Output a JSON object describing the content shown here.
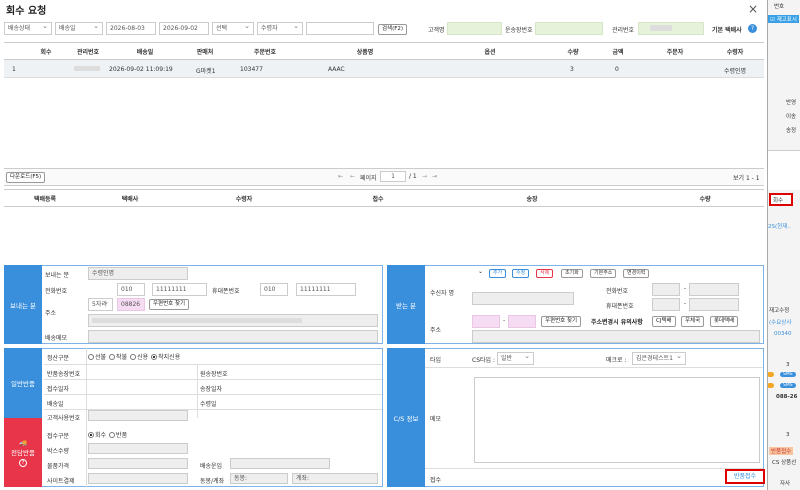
{
  "modal": {
    "title": "회수 요청",
    "close": "×"
  },
  "filters": {
    "status": "배송상태",
    "date_type": "배송일",
    "date_from": "2026-08-03",
    "date_to": "2026-09-02",
    "select": "선택",
    "receiver": "수령자",
    "search_btn": "검색(F2)",
    "customer_label": "고객명",
    "tracking_label": "운송장번호",
    "mgmt_label": "관리번호",
    "default_courier": "기본 택배사",
    "help": "?"
  },
  "orders_table": {
    "headers": [
      "회수",
      "관리번호",
      "배송일",
      "판매처",
      "주문번호",
      "상품명",
      "옵션",
      "수량",
      "금액",
      "주문자",
      "수령자"
    ],
    "rows": [
      {
        "no": "1",
        "date": "2026-09-02 11:09:19",
        "seller": "G마켓1",
        "order_no": "103477",
        "product": "AAAC",
        "option": "",
        "qty": "3",
        "amount": "0",
        "orderer": "",
        "receiver": "수령인명"
      }
    ]
  },
  "pager": {
    "download": "다운로드(F5)",
    "first": "⇤",
    "prev": "←",
    "page_label": "페이지",
    "page": "1",
    "total": "/ 1",
    "next": "→",
    "last": "⇥",
    "view": "보기 1 - 1"
  },
  "courier_table": {
    "headers": [
      "택배등록",
      "택배사",
      "수령자",
      "접수",
      "송장",
      "수량"
    ]
  },
  "sender": {
    "section": "보내는 분",
    "name_label": "보내는 분",
    "name_value": "수령인명",
    "phone_label": "전화번호",
    "phone1": "010",
    "phone2": "11111111",
    "mobile_label": "휴대폰번호",
    "mobile1": "010",
    "mobile2": "11111111",
    "addr_label": "주소",
    "region": "5자리",
    "zip": "08826",
    "zip_btn": "우편번호 찾기",
    "memo_label": "배송메모"
  },
  "receiver": {
    "section": "받는 분",
    "name_label": "수신자 명",
    "btns": [
      "추가",
      "수정",
      "삭제",
      "초기화",
      "기본주소",
      "변경이력"
    ],
    "phone_label": "전화번호",
    "mobile_label": "휴대폰번호",
    "addr_label": "주소",
    "zip_btn": "우편번호 찾기",
    "caution": "주소변경시 유의사항",
    "courier_btns": [
      "CJ택배",
      "우체국",
      "롯데택배"
    ]
  },
  "general": {
    "section": "일반반품",
    "settle_label": "정산구분",
    "settle_options": [
      "선불",
      "착불",
      "신용",
      "착지신용"
    ],
    "settle_selected": 3,
    "return_tracking_label": "반품송장번호",
    "orig_tracking_label": "원송장번호",
    "accept_date_label": "접수일자",
    "invoice_date_label": "송장일자",
    "ship_date_label": "배송일",
    "receipt_date_label": "수령일",
    "customer_no_label": "고객사용번호"
  },
  "cnt": {
    "section": "전담반품",
    "accept_type_label": "접수구분",
    "accept_options": [
      "회수",
      "반품"
    ],
    "accept_selected": 0,
    "box_qty_label": "박스수량",
    "item_price_label": "물품가격",
    "ship_fee_label": "배송운임",
    "site_settle_label": "사이트결제",
    "combine_label": "동봉/계좌",
    "combine_value": "동봉:",
    "account_value": "계좌:"
  },
  "cs": {
    "section": "C/S 정보",
    "type_label": "타입",
    "cs_type_label": "CS타입 :",
    "cs_type_value": "일반",
    "macro_label": "매크로 :",
    "macro_value": "김은경테스트1",
    "memo_label": "메모",
    "accept_label": "접수",
    "accept_btn": "반품접수"
  },
  "bg_app": {
    "top_text": "번호",
    "stock_label": "재고표시",
    "items": [
      "반영",
      "이송",
      "송정"
    ],
    "recall": "회수",
    "row_text": "2S(현재..",
    "inv_label": "재고수정",
    "inv_sub": "(수요상사",
    "inv_num": "00340",
    "num3a": "3",
    "sms": "SMS",
    "phone": "088-26",
    "num3b": "3",
    "return_tag": "반품접수",
    "cs_tag": "CS 상품선",
    "bottom": "자사"
  },
  "colors": {
    "accent_blue": "#3a8fdc",
    "cnt_red": "#e8354a",
    "highlight_red": "#d00000"
  }
}
